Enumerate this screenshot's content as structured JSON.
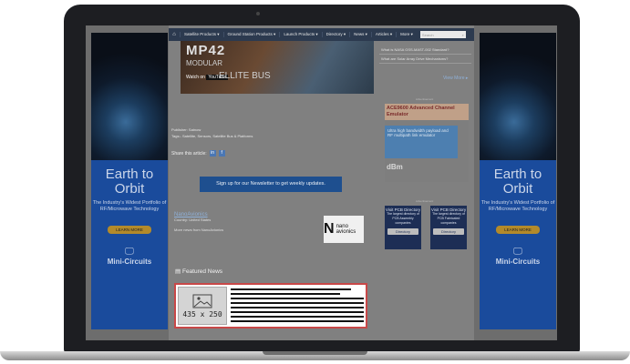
{
  "nav": {
    "items": [
      "Satellite Products ▾",
      "Ground Station Products ▾",
      "Launch Products ▾",
      "Directory ▾",
      "News ▾",
      "Articles ▾",
      "More ▾"
    ],
    "search_placeholder": "Search"
  },
  "hero": {
    "line1": "MP42",
    "line2": "MODULAR",
    "watch_on": "Watch on",
    "youtube": "YouTube",
    "line3": "ELLITE BUS"
  },
  "side_links": [
    "What is NASA GSS-MAST-002 Standard?",
    "What are Solar Array Drive Mechanisms?"
  ],
  "view_more": "View More ▸",
  "meta": {
    "publisher": "Publisher: Satnow",
    "tags": "Tags:- Satellite, Sensors, Satellite Bus & Platforms"
  },
  "share": {
    "label": "Share this article:",
    "buttons": [
      "in",
      "f"
    ]
  },
  "newsletter_label": "Sign up for our Newsletter to get weekly updates.",
  "company": {
    "name": "NanoAvionics",
    "country": "Country: United States",
    "more": "More news from NanoAvionics",
    "logo_text": "nano avionics"
  },
  "featured_title": "Featured News",
  "placeholder_label": "435 x 250",
  "left_ad": {
    "big": "Earth to Orbit",
    "small": "The Industry's Widest Portfolio of RF/Microwave Technology",
    "learn": "LEARN MORE",
    "brand": "Mini-Circuits"
  },
  "right_ad": {
    "big": "Earth to Orbit",
    "small": "The Industry's Widest Portfolio of RF/Microwave Technology",
    "learn": "LEARN MORE",
    "brand": "Mini-Circuits"
  },
  "dbm_ad": {
    "head": "ACE9600 Advanced Channel Emulator",
    "body": "Ultra high bandwidth payload and RF multipath link emulator",
    "logo": "dBm"
  },
  "directory_boxes": [
    {
      "title": "Visit PCB Directory",
      "text": "The largest directory of PCB Assembly companies",
      "pill": "Directory"
    },
    {
      "title": "Visit PCB Directory",
      "text": "The largest directory of PCB Fabricated companies",
      "pill": "Directory"
    }
  ],
  "ad_tag": "Advertisement"
}
